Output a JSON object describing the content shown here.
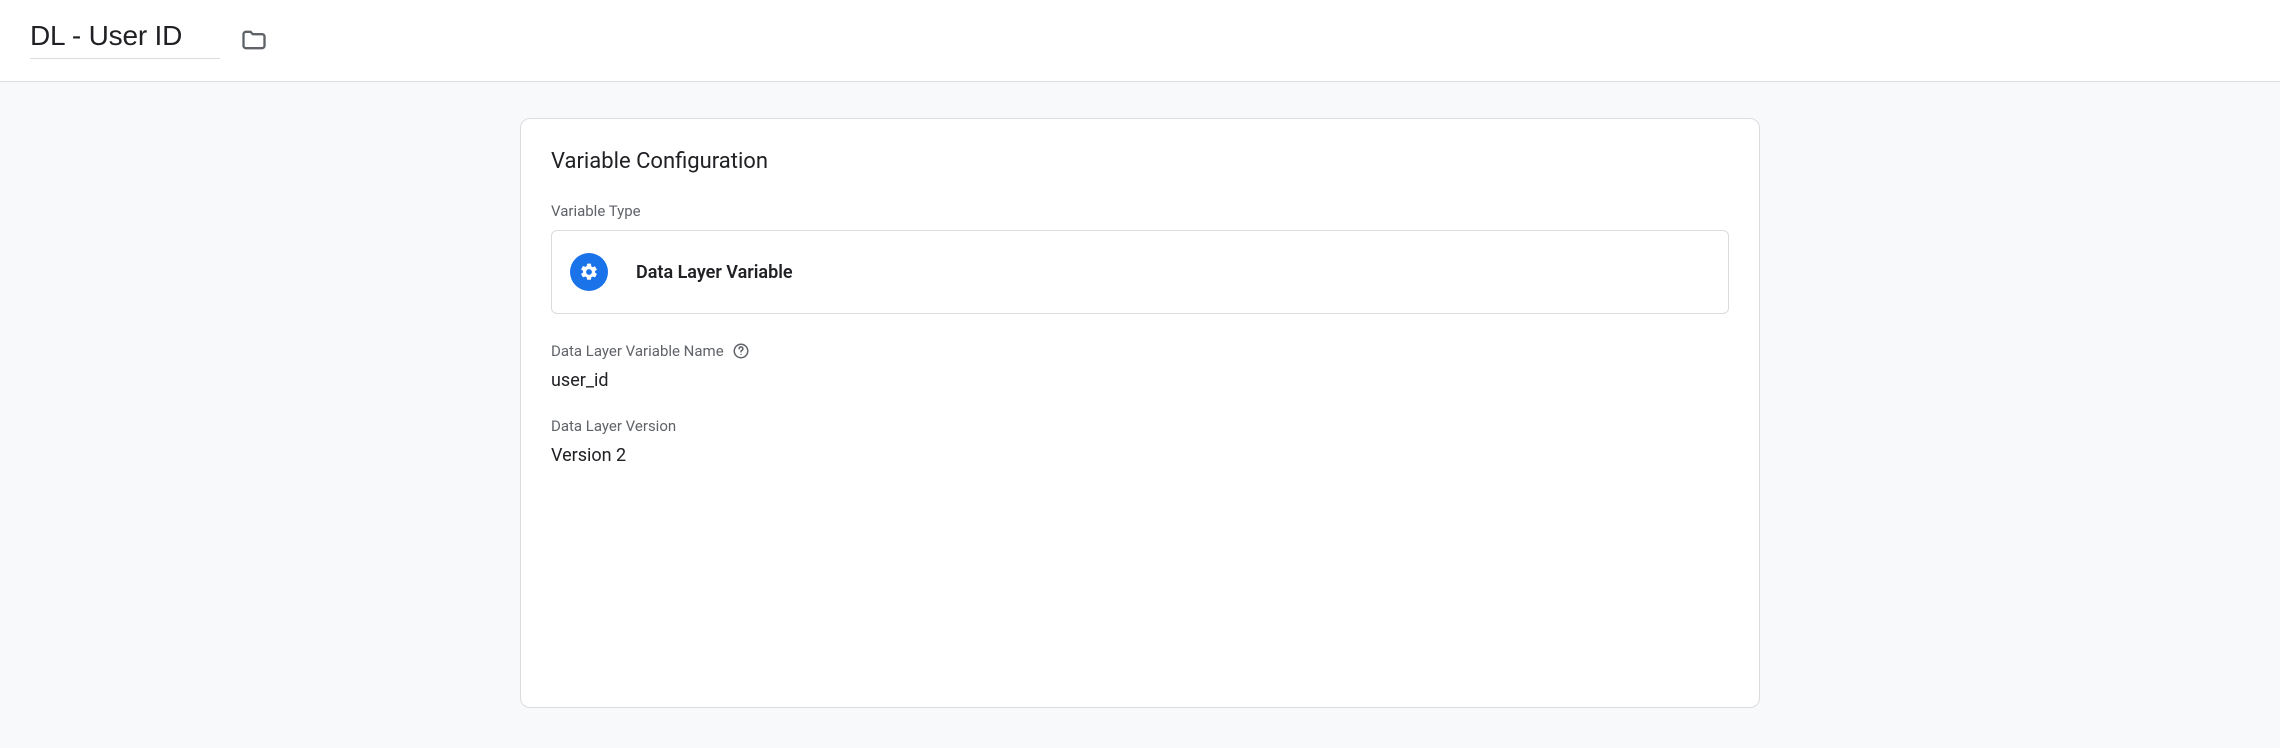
{
  "header": {
    "title": "DL - User ID"
  },
  "card": {
    "title": "Variable Configuration",
    "type_label": "Variable Type",
    "type_name": "Data Layer Variable",
    "fields": {
      "name_label": "Data Layer Variable Name",
      "name_value": "user_id",
      "version_label": "Data Layer Version",
      "version_value": "Version 2"
    }
  }
}
